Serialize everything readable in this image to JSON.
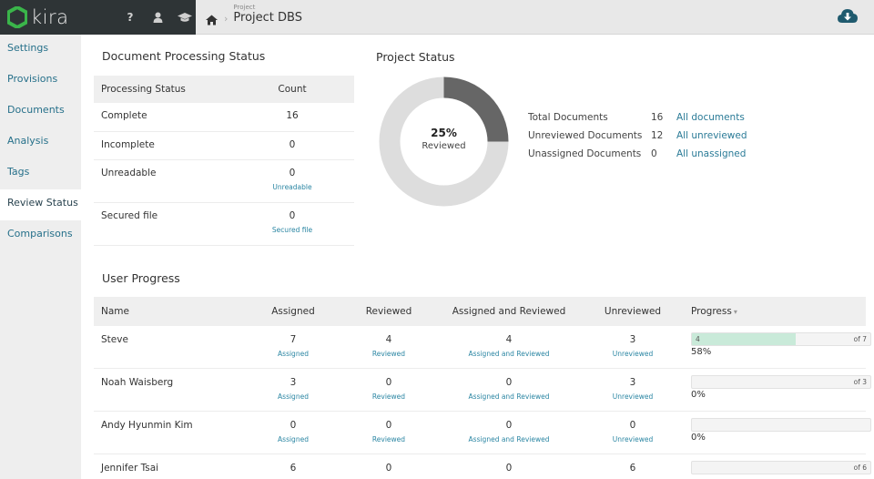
{
  "app": {
    "logo_text": "kira",
    "brand_color": "#3ab54a"
  },
  "topbar": {
    "icons": [
      "help-icon",
      "user-icon",
      "graduation-cap-icon"
    ],
    "help_glyph": "?",
    "breadcrumb_parent": "Project",
    "breadcrumb_title": "Project DBS",
    "download_icon": "cloud-download-icon"
  },
  "sidebar": {
    "items": [
      {
        "label": "Settings"
      },
      {
        "label": "Provisions"
      },
      {
        "label": "Documents"
      },
      {
        "label": "Analysis"
      },
      {
        "label": "Tags"
      },
      {
        "label": "Review Status",
        "active": true
      },
      {
        "label": "Comparisons"
      }
    ]
  },
  "doc_processing": {
    "title": "Document Processing Status",
    "headers": {
      "status": "Processing Status",
      "count": "Count"
    },
    "rows": [
      {
        "status": "Complete",
        "count": "16",
        "link": ""
      },
      {
        "status": "Incomplete",
        "count": "0",
        "link": ""
      },
      {
        "status": "Unreadable",
        "count": "0",
        "link": "Unreadable"
      },
      {
        "status": "Secured file",
        "count": "0",
        "link": "Secured file"
      }
    ]
  },
  "project_status": {
    "title": "Project Status",
    "reviewed_percent": 25,
    "percent_label": "25%",
    "sub_label": "Reviewed",
    "colors": {
      "reviewed": "#666666",
      "remaining": "#dddddd"
    },
    "stats": [
      {
        "label": "Total Documents",
        "value": "16",
        "link": "All documents"
      },
      {
        "label": "Unreviewed Documents",
        "value": "12",
        "link": "All unreviewed"
      },
      {
        "label": "Unassigned Documents",
        "value": "0",
        "link": "All unassigned"
      }
    ]
  },
  "user_progress": {
    "title": "User Progress",
    "headers": {
      "name": "Name",
      "assigned": "Assigned",
      "reviewed": "Reviewed",
      "assigned_reviewed": "Assigned and Reviewed",
      "unreviewed": "Unreviewed",
      "progress": "Progress",
      "sort_glyph": "▾"
    },
    "link_labels": {
      "assigned": "Assigned",
      "reviewed": "Reviewed",
      "assigned_reviewed": "Assigned and Reviewed",
      "unreviewed": "Unreviewed"
    },
    "rows": [
      {
        "name": "Steve",
        "assigned": "7",
        "reviewed": "4",
        "assigned_reviewed": "4",
        "unreviewed": "3",
        "progress_done": "4",
        "progress_of": "of 7",
        "progress_fraction": 0.58,
        "percent": "58%"
      },
      {
        "name": "Noah Waisberg",
        "assigned": "3",
        "reviewed": "0",
        "assigned_reviewed": "0",
        "unreviewed": "3",
        "progress_done": "",
        "progress_of": "of 3",
        "progress_fraction": 0,
        "percent": "0%"
      },
      {
        "name": "Andy Hyunmin Kim",
        "assigned": "0",
        "reviewed": "0",
        "assigned_reviewed": "0",
        "unreviewed": "0",
        "progress_done": "",
        "progress_of": "",
        "progress_fraction": 0,
        "percent": "0%"
      },
      {
        "name": "Jennifer Tsai",
        "assigned": "6",
        "reviewed": "0",
        "assigned_reviewed": "0",
        "unreviewed": "6",
        "progress_done": "",
        "progress_of": "of 6",
        "progress_fraction": 0,
        "percent": ""
      }
    ]
  }
}
